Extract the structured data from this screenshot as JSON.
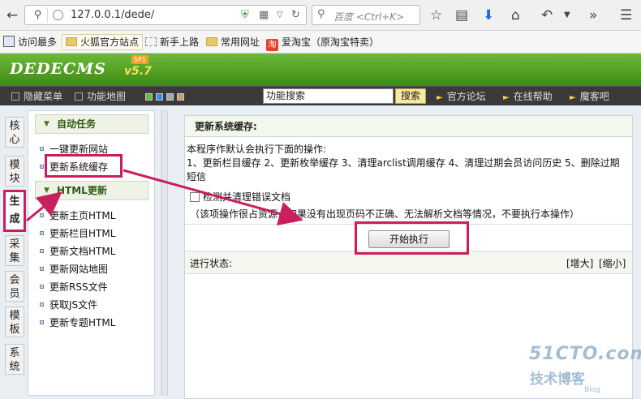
{
  "browser": {
    "url": "127.0.0.1/dede/",
    "search_placeholder": "百度 <Ctrl+K>"
  },
  "bookmarks": [
    {
      "label": "访问最多"
    },
    {
      "label": "火狐官方站点"
    },
    {
      "label": "新手上路"
    },
    {
      "label": "常用网址"
    },
    {
      "label": "爱淘宝（原淘宝特卖）"
    }
  ],
  "bookmark_badge": "淘",
  "app": {
    "logo": "DEDECMS",
    "version": "v5.7",
    "sp": "SP1"
  },
  "topnav": {
    "hide_menu": "隐藏菜单",
    "site_map": "功能地图",
    "search_value": "功能搜索",
    "search_button": "搜索",
    "links": [
      "官方论坛",
      "在线帮助",
      "魔客吧"
    ]
  },
  "vtabs": [
    "核心",
    "模块",
    "生成",
    "采集",
    "会员",
    "模板",
    "系统"
  ],
  "menu": {
    "group1_title": "自动任务",
    "group1_items": [
      "一键更新网站",
      "更新系统缓存"
    ],
    "group2_title": "HTML更新",
    "group2_items": [
      "更新主页HTML",
      "更新栏目HTML",
      "更新文档HTML",
      "更新网站地图",
      "更新RSS文件",
      "获取JS文件",
      "更新专题HTML"
    ]
  },
  "main": {
    "title": "更新系统缓存:",
    "desc_line1": "本程序作默认会执行下面的操作:",
    "desc_line2": "1、更新栏目缓存 2、更新枚举缓存 3、清理arclist调用缓存 4、清理过期会员访问历史 5、删除过期短信",
    "checkbox_label": "检测并清理错误文档",
    "note": "（该项操作很占资源，如果没有出现页码不正确、无法解析文档等情况，不要执行本操作）",
    "start_button": "开始执行",
    "progress_label": "进行状态:",
    "enlarge": "[增大]",
    "shrink": "[缩小]"
  },
  "watermark": {
    "line1": "51CTO.com",
    "line2": "技术博客",
    "line3": "Blog"
  },
  "colors": {
    "highlight": "#c8205f",
    "header_green": "#4f9a1f",
    "nav_dark": "#3a3a3a"
  }
}
